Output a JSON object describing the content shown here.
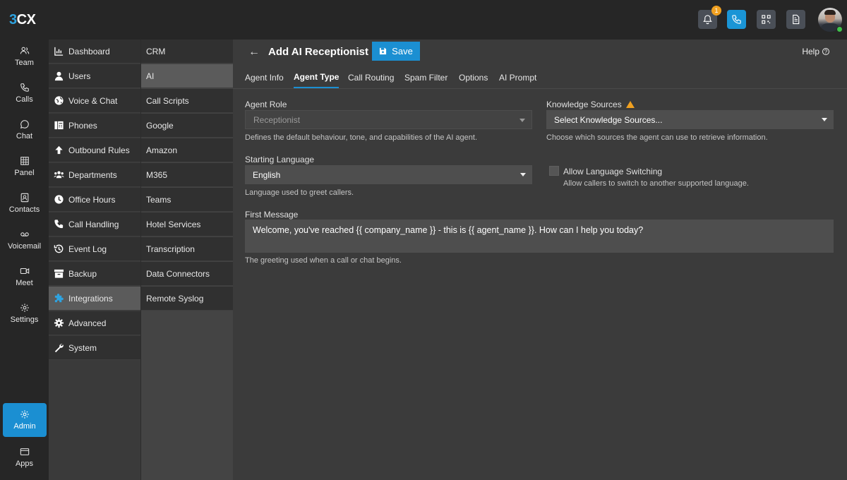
{
  "app": {
    "logo_prefix": "3",
    "logo_suffix": "CX"
  },
  "topbar": {
    "notification_count": "1"
  },
  "rail": [
    {
      "label": "Team",
      "icon": "team-icon"
    },
    {
      "label": "Calls",
      "icon": "phone-icon"
    },
    {
      "label": "Chat",
      "icon": "chat-icon"
    },
    {
      "label": "Panel",
      "icon": "grid-icon"
    },
    {
      "label": "Contacts",
      "icon": "contacts-icon"
    },
    {
      "label": "Voicemail",
      "icon": "voicemail-icon"
    },
    {
      "label": "Meet",
      "icon": "video-icon"
    },
    {
      "label": "Settings",
      "icon": "gear-icon"
    },
    {
      "label": "Admin",
      "icon": "gear-icon"
    },
    {
      "label": "Apps",
      "icon": "apps-icon"
    }
  ],
  "menu1": [
    {
      "label": "Dashboard"
    },
    {
      "label": "Users"
    },
    {
      "label": "Voice & Chat"
    },
    {
      "label": "Phones"
    },
    {
      "label": "Outbound Rules"
    },
    {
      "label": "Departments"
    },
    {
      "label": "Office Hours"
    },
    {
      "label": "Call Handling"
    },
    {
      "label": "Event Log"
    },
    {
      "label": "Backup"
    },
    {
      "label": "Integrations"
    },
    {
      "label": "Advanced"
    },
    {
      "label": "System"
    }
  ],
  "menu2": [
    {
      "label": "CRM"
    },
    {
      "label": "AI"
    },
    {
      "label": "Call Scripts"
    },
    {
      "label": "Google"
    },
    {
      "label": "Amazon"
    },
    {
      "label": "M365"
    },
    {
      "label": "Teams"
    },
    {
      "label": "Hotel Services"
    },
    {
      "label": "Transcription"
    },
    {
      "label": "Data Connectors"
    },
    {
      "label": "Remote Syslog"
    }
  ],
  "header": {
    "back": "←",
    "title": "Add AI Receptionist",
    "save": "Save",
    "help": "Help",
    "help_icon": "?"
  },
  "tabs": [
    "Agent Info",
    "Agent Type",
    "Call Routing",
    "Spam Filter",
    "Options",
    "AI Prompt"
  ],
  "form": {
    "agent_role": {
      "label": "Agent Role",
      "value": "Receptionist",
      "hint": "Defines the default behaviour, tone, and capabilities of the AI agent."
    },
    "knowledge": {
      "label": "Knowledge Sources",
      "value": "Select Knowledge Sources...",
      "hint": "Choose which sources the agent can use to retrieve information."
    },
    "language": {
      "label": "Starting Language",
      "value": "English",
      "hint": "Language used to greet callers."
    },
    "switching": {
      "label": "Allow Language Switching",
      "hint": "Allow callers to switch to another supported language."
    },
    "first_message": {
      "label": "First Message",
      "value": "Welcome, you've reached {{ company_name }} - this is {{ agent_name }}. How can I help you today?",
      "hint": "The greeting used when a call or chat begins."
    }
  }
}
